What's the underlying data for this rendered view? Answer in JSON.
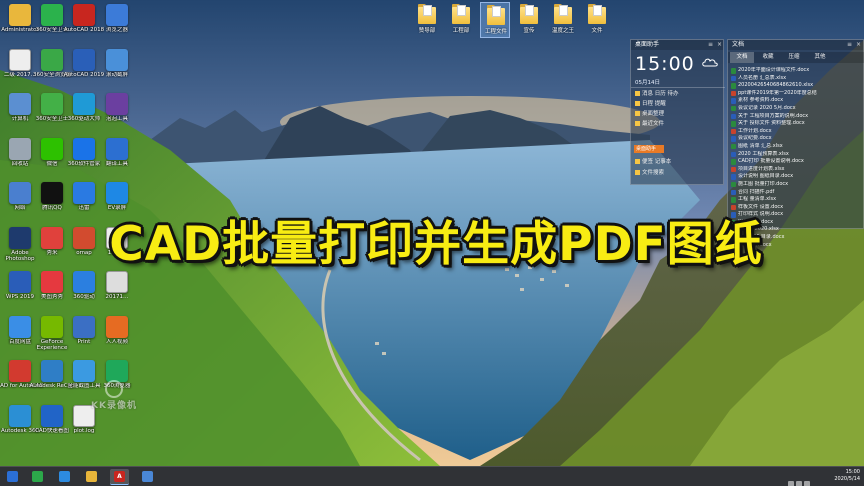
{
  "overlay_title": "CAD批量打印并生成PDF图纸",
  "watermark": "KK录像机",
  "colors": {
    "title_fill": "#f8ec13",
    "title_outline": "#111111",
    "taskbar": "#1c2430",
    "widget_bg": "#28374b"
  },
  "desktop_icons": [
    {
      "label": "Administrator",
      "icon": "user-folder-icon",
      "color": "#e9b73c"
    },
    {
      "label": "360安全卫士",
      "icon": "360-guard-icon",
      "color": "#2bb24c"
    },
    {
      "label": "AutoCAD 2018",
      "icon": "autocad-icon",
      "color": "#c8261f"
    },
    {
      "label": "浏览之器",
      "icon": "browser-icon",
      "color": "#3c7bd8"
    },
    {
      "label": "二级 2017…",
      "icon": "doc-icon",
      "color": "#eeeeee"
    },
    {
      "label": "360安全浏览器",
      "icon": "360-browser-icon",
      "color": "#3aa847"
    },
    {
      "label": "AutoCAD 2019",
      "icon": "autocad-blue-icon",
      "color": "#2a5fb8"
    },
    {
      "label": "滚动截屏",
      "icon": "screenshot-icon",
      "color": "#4a90d9"
    },
    {
      "label": "计算机",
      "icon": "computer-icon",
      "color": "#5b8fd1"
    },
    {
      "label": "360安全卫士",
      "icon": "360-shield-icon",
      "color": "#43b047"
    },
    {
      "label": "360驱动大师",
      "icon": "driver-icon",
      "color": "#1f9ad6"
    },
    {
      "label": "泡泡工具",
      "icon": "tools-icon",
      "color": "#6b3fa0"
    },
    {
      "label": "回收站",
      "icon": "recycle-bin-icon",
      "color": "#9aa6b2"
    },
    {
      "label": "微信",
      "icon": "wechat-icon",
      "color": "#2dc100"
    },
    {
      "label": "360软件管家",
      "icon": "software-manager-icon",
      "color": "#1a73e8"
    },
    {
      "label": "翻译工具",
      "icon": "translate-icon",
      "color": "#2c6fd1"
    },
    {
      "label": "网络",
      "icon": "network-icon",
      "color": "#4a7fcf"
    },
    {
      "label": "腾讯QQ",
      "icon": "qq-icon",
      "color": "#111111"
    },
    {
      "label": "迅雷",
      "icon": "thunder-icon",
      "color": "#2a7ae2"
    },
    {
      "label": "EV录屏",
      "icon": "recorder-icon",
      "color": "#1e88e5"
    },
    {
      "label": "Adobe Photoshop",
      "icon": "photoshop-icon",
      "color": "#1e3a6d"
    },
    {
      "label": "秀米",
      "icon": "xiumi-icon",
      "color": "#e0413c"
    },
    {
      "label": "omap",
      "icon": "map-app-icon",
      "color": "#d24b2f"
    },
    {
      "label": "1.docx",
      "icon": "word-doc-icon",
      "color": "#eeeeee"
    },
    {
      "label": "WPS 2019",
      "icon": "wps-icon",
      "color": "#2a5db8"
    },
    {
      "label": "美图秀秀",
      "icon": "meitu-icon",
      "color": "#e5393f"
    },
    {
      "label": "360驱动",
      "icon": "driver-blue-icon",
      "color": "#2b7fe0"
    },
    {
      "label": "20171…",
      "icon": "image-file-icon",
      "color": "#dddddd"
    },
    {
      "label": "百度网盘",
      "icon": "baidu-pan-icon",
      "color": "#3a8ee6"
    },
    {
      "label": "GeForce Experience",
      "icon": "geforce-icon",
      "color": "#76b900"
    },
    {
      "label": "Print",
      "icon": "printer-icon",
      "color": "#3b6fc4"
    },
    {
      "label": "人人视频",
      "icon": "video-app-icon",
      "color": "#e66b22"
    },
    {
      "label": "CAD for AutoCAD",
      "icon": "cad-tool-icon",
      "color": "#d23a2f"
    },
    {
      "label": "Autodesk ReCap",
      "icon": "recap-icon",
      "color": "#2f7ec6"
    },
    {
      "label": "全能截图工具",
      "icon": "capture-tool-icon",
      "color": "#3b9ae1"
    },
    {
      "label": "360浏览器",
      "icon": "360-globe-icon",
      "color": "#1fa85a"
    },
    {
      "label": "Autodesk 360",
      "icon": "autodesk-360-icon",
      "color": "#2b8fd4"
    },
    {
      "label": "CAD快速看图",
      "icon": "cad-viewer-icon",
      "color": "#2164c7"
    },
    {
      "label": "plot.log",
      "icon": "log-file-icon",
      "color": "#eeeeee"
    }
  ],
  "top_folders": [
    {
      "label": "赞导部",
      "selected": false
    },
    {
      "label": "工程部",
      "selected": false
    },
    {
      "label": "工程文件",
      "selected": true
    },
    {
      "label": "宣传",
      "selected": false
    },
    {
      "label": "温度之王",
      "selected": false
    },
    {
      "label": "文件",
      "selected": false
    }
  ],
  "clock_widget": {
    "header": "桌面助手",
    "time": "15:00",
    "date": "05月14日",
    "rows": [
      "消息 日历 待办",
      "日程 提醒",
      "桌面整理",
      "最近文件",
      "便签 记事本",
      "文件搜索"
    ],
    "button": "桌面助手"
  },
  "docs_widget": {
    "header": "文档",
    "tabs": [
      "文档",
      "收藏",
      "压缩",
      "其他"
    ],
    "items": [
      "2020年平面设计课程文件.docx",
      "人员名册 汇总表.xlsx",
      "20200426540684862610.xlsx",
      "ppt课件2019年第一2020年度总结",
      "素材 参考资料.docx",
      "会议记录 2020 5月.docx",
      "关于 工程项目方案的说明.docx",
      "关于 投标文件 资料整理.docx",
      "工作计划.docx",
      "会议纪要.docx",
      "图纸 清单 汇总.xlsx",
      "2020 工程预算表.xlsx",
      "CAD打印 批量设置说明.docx",
      "项目进度计划表.xlsx",
      "设计说明 图纸目录.docx",
      "施工图 批量打印.docx",
      "合同 扫描件.pdf",
      "工程 量清单.xlsx",
      "样板文件 设置.docx",
      "打印样式 说明.docx",
      "图框 模板.docx",
      "汇总表 2020.xlsx",
      "图纸 PDF 目录.docx",
      "说明文件.docx"
    ]
  },
  "taskbar": {
    "buttons": [
      {
        "icon": "start-icon",
        "color": "#2b6fd6",
        "text": ""
      },
      {
        "icon": "360-taskbar-icon",
        "color": "#2ca84a",
        "text": ""
      },
      {
        "icon": "browser-taskbar-icon",
        "color": "#2d8be0",
        "text": ""
      },
      {
        "icon": "explorer-taskbar-icon",
        "color": "#e8b53a",
        "text": ""
      },
      {
        "icon": "autocad-taskbar-icon",
        "color": "#c8261f",
        "text": "A"
      },
      {
        "icon": "media-taskbar-icon",
        "color": "#4a87d6",
        "text": ""
      }
    ],
    "time": "15:00",
    "date": "2020/5/14"
  }
}
